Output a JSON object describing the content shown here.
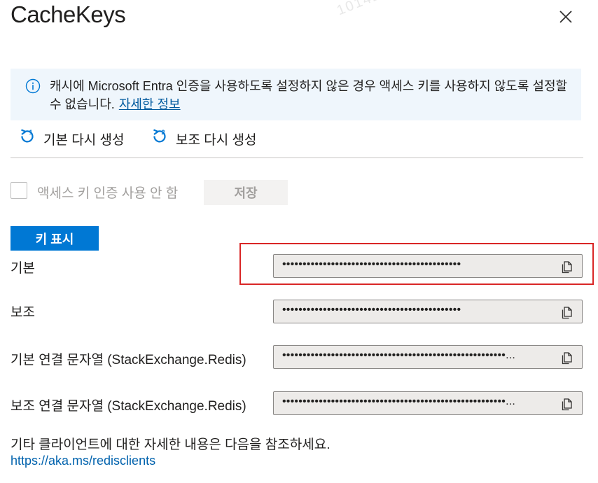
{
  "panel": {
    "title": "CacheKeys",
    "watermark": "10142808"
  },
  "info": {
    "message": "캐시에 Microsoft Entra 인증을 사용하도록 설정하지 않은 경우 액세스 키를 사용하지 않도록 설정할 수 없습니다.",
    "link": "자세한 정보"
  },
  "commands": {
    "regen_primary": "기본 다시 생성",
    "regen_secondary": "보조 다시 생성"
  },
  "access": {
    "checkbox_label": "액세스 키 인증 사용 안 함",
    "checked": false,
    "save_label": "저장"
  },
  "show_keys_label": "키 표시",
  "keys": [
    {
      "label": "기본",
      "value": "••••••••••••••••••••••••••••••••••••••••••••"
    },
    {
      "label": "보조",
      "value": "••••••••••••••••••••••••••••••••••••••••••••"
    },
    {
      "label": "기본 연결 문자열 (StackExchange.Redis)",
      "value": "•••••••••••••••••••••••••••••••••••••••••••••••••••••••..."
    },
    {
      "label": "보조 연결 문자열 (StackExchange.Redis)",
      "value": "•••••••••••••••••••••••••••••••••••••••••••••••••••••••..."
    }
  ],
  "footer": {
    "text": "기타 클라이언트에 대한 자세한 내용은 다음을 참조하세요.",
    "link": "https://aka.ms/redisclients"
  },
  "colors": {
    "accent": "#0078d4",
    "info_background": "#eff6fc",
    "highlight": "#d92626",
    "link": "#0062ad"
  }
}
